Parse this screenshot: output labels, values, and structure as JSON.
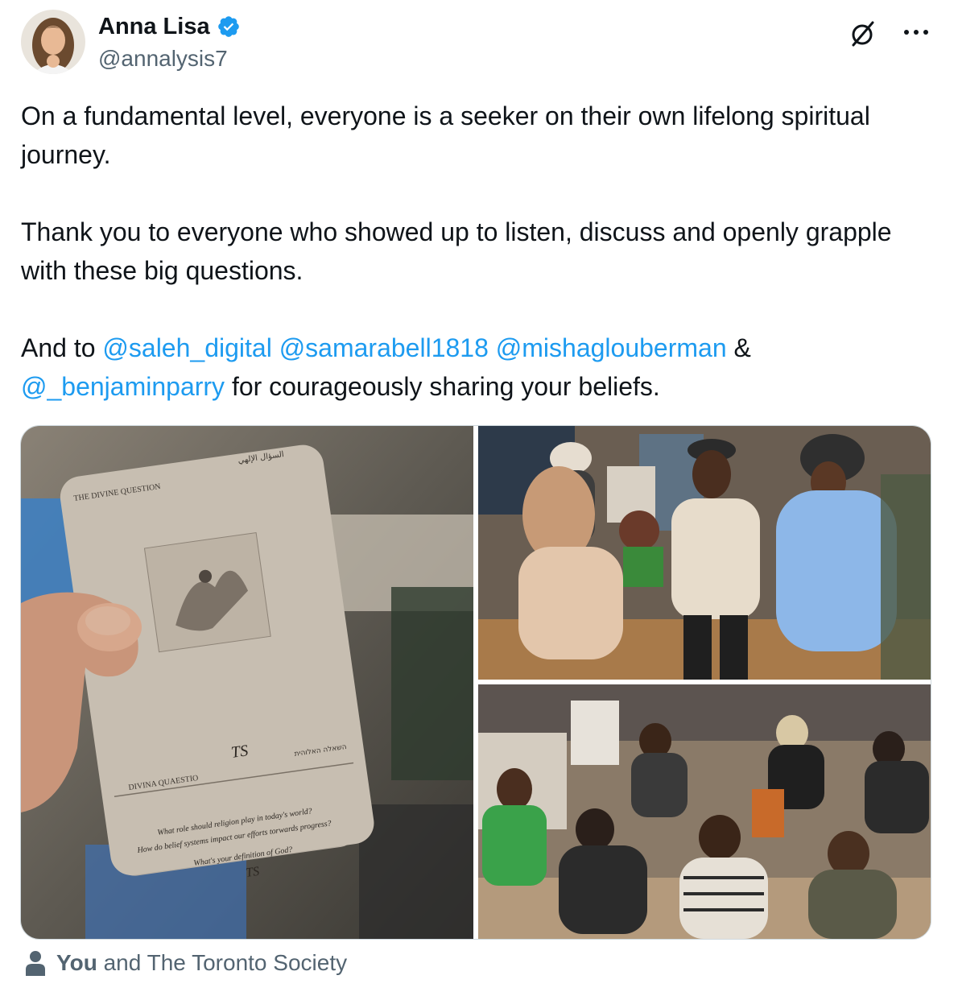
{
  "author": {
    "display_name": "Anna Lisa",
    "handle": "@annalysis7",
    "verified": true,
    "avatar_icon": "avatar-photo"
  },
  "actions": {
    "grok_icon": "grok-icon",
    "more_icon": "more-icon"
  },
  "tweet": {
    "paragraph1": "On a fundamental level, everyone is a seeker on their own lifelong spiritual journey.",
    "paragraph2": "Thank you to everyone who showed up to listen, discuss and openly grapple with these big questions.",
    "p3_prefix": "And to ",
    "mentions": [
      "@saleh_digital",
      "@samarabell1818",
      "@mishaglouberman",
      "@_benjaminparry"
    ],
    "p3_amp": " & ",
    "p3_suffix": " for courageously sharing your beliefs."
  },
  "media": {
    "photos": [
      {
        "name": "card-photo",
        "card_heading": "THE DIVINE QUESTION",
        "card_arabic": "السؤال الإلهي",
        "card_hebrew": "השאלה האלוהית",
        "card_latin": "DIVINA QUAESTIO",
        "card_logo": "TS",
        "card_q1": "What role should religion play in today's world?",
        "card_q2": "How do belief systems impact our efforts torwards progress?",
        "card_q3": "What's your definition of God?"
      },
      {
        "name": "standing-group-photo"
      },
      {
        "name": "seated-crowd-photo"
      }
    ]
  },
  "tagged": {
    "you": "You",
    "rest": "and The Toronto Society"
  },
  "colors": {
    "text": "#0f1419",
    "secondary": "#536471",
    "link": "#1d9bf0",
    "verified": "#1d9bf0",
    "border": "#cfd9de"
  }
}
